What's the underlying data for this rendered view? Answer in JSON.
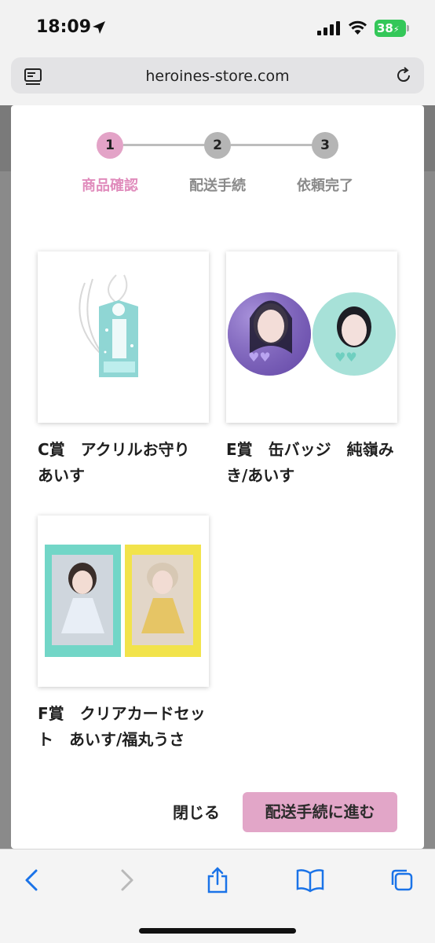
{
  "status_bar": {
    "time": "18:09",
    "battery": "38",
    "icons": [
      "location-arrow-icon",
      "cellular-signal-icon",
      "wifi-icon",
      "battery-icon"
    ]
  },
  "browser": {
    "url": "heroines-store.com",
    "icons": [
      "tabs-overview-icon",
      "reload-icon"
    ]
  },
  "modal": {
    "steps": [
      {
        "number": "1",
        "label": "商品確認",
        "active": true
      },
      {
        "number": "2",
        "label": "配送手続",
        "active": false
      },
      {
        "number": "3",
        "label": "依頼完了",
        "active": false
      }
    ],
    "items": [
      {
        "name": "C賞　アクリルお守り　あいす",
        "image": "acrylic-omamori-image"
      },
      {
        "name": "E賞　缶バッジ　純嶺みき/あいす",
        "image": "can-badges-image"
      },
      {
        "name": "F賞　クリアカードセット　あいす/福丸うさ",
        "image": "clear-card-set-image"
      }
    ],
    "close_label": "閉じる",
    "proceed_label": "配送手続に進む"
  },
  "toolbar": {
    "icons": [
      "back-icon",
      "forward-icon",
      "share-icon",
      "bookmarks-icon",
      "tabs-icon"
    ]
  },
  "colors": {
    "accent_pink": "#e2a6c8",
    "active_step_text": "#e08cbc",
    "inactive_step": "#b5b5b5",
    "ios_blue": "#1a73e8"
  }
}
